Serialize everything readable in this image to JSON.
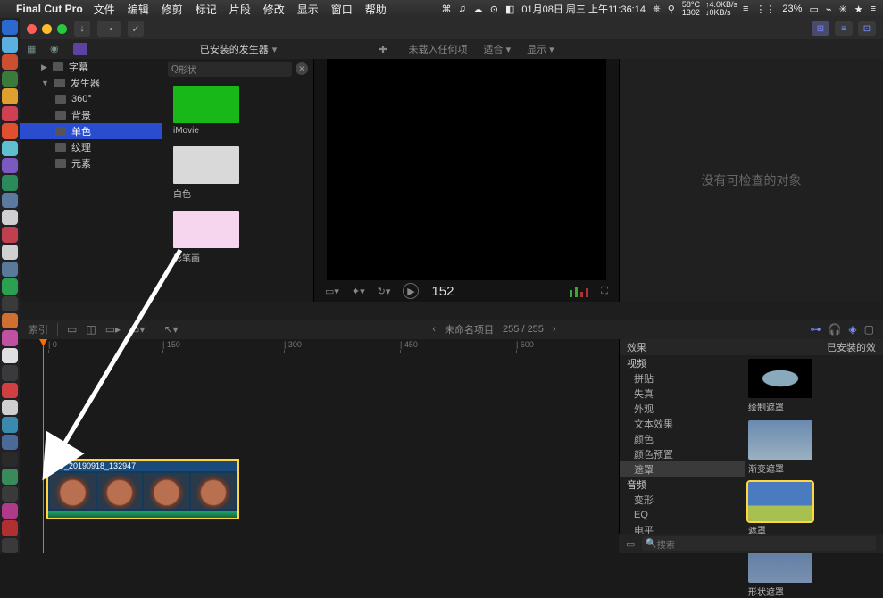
{
  "menubar": {
    "app_name": "Final Cut Pro",
    "items": [
      "文件",
      "编辑",
      "修剪",
      "标记",
      "片段",
      "修改",
      "显示",
      "窗口",
      "帮助"
    ],
    "status": {
      "datetime": "01月08日 周三 上午11:36:14",
      "battery": "23%",
      "temp_top": "58°C",
      "temp_bottom": "1302",
      "net_top": "↑4.0KB/s",
      "net_bottom": "↓0KB/s"
    }
  },
  "browser": {
    "title": "已安装的发生器",
    "search_prefix": "Q",
    "search_value": "形状",
    "sidebar": [
      {
        "label": "字幕",
        "level": 2,
        "disc": "▶",
        "sel": false
      },
      {
        "label": "发生器",
        "level": 2,
        "disc": "▼",
        "sel": false
      },
      {
        "label": "360°",
        "level": 3,
        "disc": "",
        "sel": false
      },
      {
        "label": "背景",
        "level": 3,
        "disc": "",
        "sel": false
      },
      {
        "label": "单色",
        "level": 3,
        "disc": "",
        "sel": true
      },
      {
        "label": "纹理",
        "level": 3,
        "disc": "",
        "sel": false
      },
      {
        "label": "元素",
        "level": 3,
        "disc": "",
        "sel": false
      }
    ],
    "generators": [
      {
        "label": "iMovie",
        "color": "#18b818"
      },
      {
        "label": "白色",
        "color": "#d9d9d9"
      },
      {
        "label": "彩笔画",
        "color": "#f6d6ee"
      }
    ]
  },
  "viewer": {
    "no_project": "未载入任何项",
    "fit": "适合",
    "show": "显示",
    "time": "152"
  },
  "inspector": {
    "empty": "没有可检查的对象"
  },
  "timeline": {
    "index_label": "索引",
    "project_name": "未命名项目",
    "range": "255 / 255",
    "ruler": [
      {
        "pos": 32,
        "label": "0"
      },
      {
        "pos": 160,
        "label": "150"
      },
      {
        "pos": 296,
        "label": "300"
      },
      {
        "pos": 426,
        "label": "450"
      },
      {
        "pos": 556,
        "label": "600"
      }
    ],
    "clip_name": "VID_20190918_132947"
  },
  "effects": {
    "header": "效果",
    "installed": "已安装的效",
    "categories": [
      {
        "label": "视频",
        "sub": false,
        "sel": false
      },
      {
        "label": "拼贴",
        "sub": true,
        "sel": false
      },
      {
        "label": "失真",
        "sub": true,
        "sel": false
      },
      {
        "label": "外观",
        "sub": true,
        "sel": false
      },
      {
        "label": "文本效果",
        "sub": true,
        "sel": false
      },
      {
        "label": "颜色",
        "sub": true,
        "sel": false
      },
      {
        "label": "颜色预置",
        "sub": true,
        "sel": false
      },
      {
        "label": "遮罩",
        "sub": true,
        "sel": true
      },
      {
        "label": "音频",
        "sub": false,
        "sel": false
      },
      {
        "label": "变形",
        "sub": true,
        "sel": false
      },
      {
        "label": "EQ",
        "sub": true,
        "sel": false
      },
      {
        "label": "电平",
        "sub": true,
        "sel": false
      }
    ],
    "items": [
      {
        "label": "绘制遮罩",
        "sel": false,
        "bg": "radial-gradient(ellipse 60% 45% at 50% 50%, #8ab 45%, #000 48%)"
      },
      {
        "label": "渐变遮罩",
        "sel": false,
        "bg": "linear-gradient(#6a8ab0,#9ab0c0)"
      },
      {
        "label": "遮罩",
        "sel": true,
        "bg": "linear-gradient(#4a7ac0 60%,#a8c050 60%)"
      },
      {
        "label": "形状遮罩",
        "sel": false,
        "bg": "linear-gradient(#5a7aa0,#7a90b0)"
      }
    ],
    "search_placeholder": "搜索"
  }
}
